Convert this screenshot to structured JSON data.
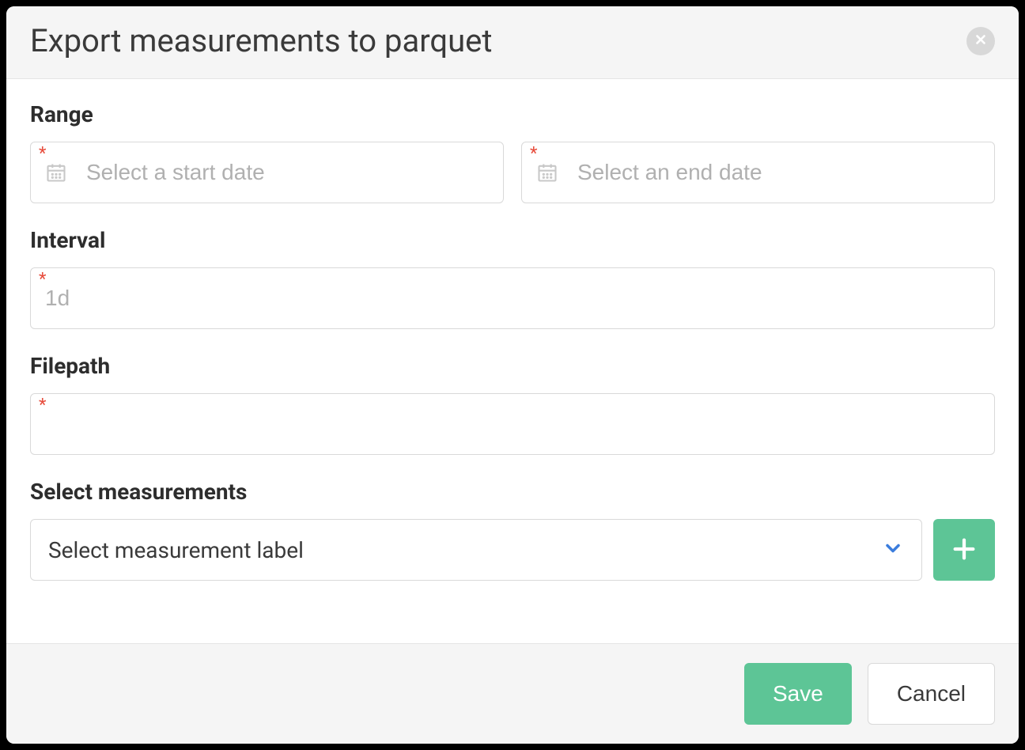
{
  "modal": {
    "title": "Export measurements to parquet"
  },
  "range": {
    "label": "Range",
    "start_placeholder": "Select a start date",
    "end_placeholder": "Select an end date"
  },
  "interval": {
    "label": "Interval",
    "placeholder": "1d",
    "value": ""
  },
  "filepath": {
    "label": "Filepath",
    "value": ""
  },
  "measurements": {
    "label": "Select measurements",
    "placeholder": "Select measurement label"
  },
  "footer": {
    "save_label": "Save",
    "cancel_label": "Cancel"
  }
}
